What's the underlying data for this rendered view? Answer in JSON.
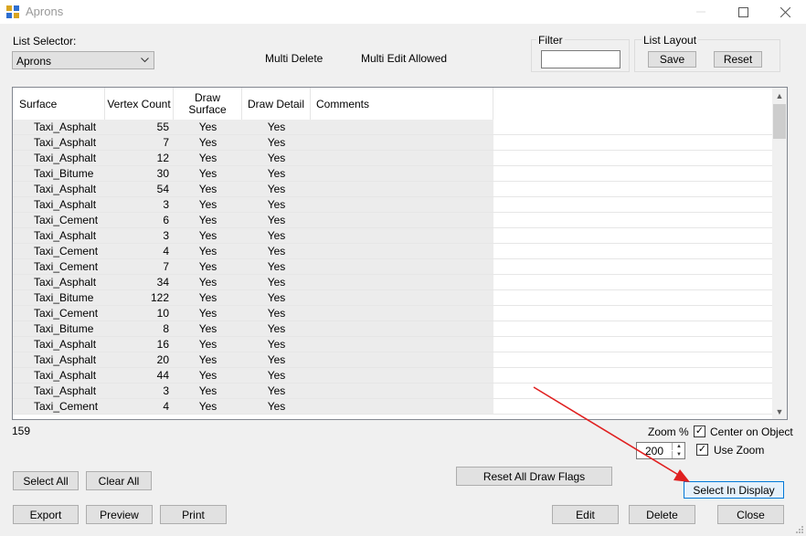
{
  "window": {
    "title": "Aprons"
  },
  "list_selector": {
    "label": "List Selector:",
    "value": "Aprons"
  },
  "multi_delete_label": "Multi Delete",
  "multi_edit_label": "Multi Edit Allowed",
  "filter": {
    "label": "Filter",
    "value": ""
  },
  "list_layout": {
    "label": "List Layout",
    "save": "Save",
    "reset": "Reset"
  },
  "columns": [
    "Surface",
    "Vertex Count",
    "Draw Surface",
    "Draw Detail",
    "Comments"
  ],
  "rows": [
    [
      "Taxi_Asphalt",
      "55",
      "Yes",
      "Yes"
    ],
    [
      "Taxi_Asphalt",
      "7",
      "Yes",
      "Yes"
    ],
    [
      "Taxi_Asphalt",
      "12",
      "Yes",
      "Yes"
    ],
    [
      "Taxi_Bitume",
      "30",
      "Yes",
      "Yes"
    ],
    [
      "Taxi_Asphalt",
      "54",
      "Yes",
      "Yes"
    ],
    [
      "Taxi_Asphalt",
      "3",
      "Yes",
      "Yes"
    ],
    [
      "Taxi_Cement",
      "6",
      "Yes",
      "Yes"
    ],
    [
      "Taxi_Asphalt",
      "3",
      "Yes",
      "Yes"
    ],
    [
      "Taxi_Cement",
      "4",
      "Yes",
      "Yes"
    ],
    [
      "Taxi_Cement",
      "7",
      "Yes",
      "Yes"
    ],
    [
      "Taxi_Asphalt",
      "34",
      "Yes",
      "Yes"
    ],
    [
      "Taxi_Bitume",
      "122",
      "Yes",
      "Yes"
    ],
    [
      "Taxi_Cement",
      "10",
      "Yes",
      "Yes"
    ],
    [
      "Taxi_Bitume",
      "8",
      "Yes",
      "Yes"
    ],
    [
      "Taxi_Asphalt",
      "16",
      "Yes",
      "Yes"
    ],
    [
      "Taxi_Asphalt",
      "20",
      "Yes",
      "Yes"
    ],
    [
      "Taxi_Asphalt",
      "44",
      "Yes",
      "Yes"
    ],
    [
      "Taxi_Asphalt",
      "3",
      "Yes",
      "Yes"
    ],
    [
      "Taxi_Cement",
      "4",
      "Yes",
      "Yes"
    ]
  ],
  "count": "159",
  "zoom": {
    "label": "Zoom %",
    "value": "200"
  },
  "center_on_object": {
    "label": "Center on Object",
    "checked": true
  },
  "use_zoom": {
    "label": "Use Zoom",
    "checked": true
  },
  "buttons": {
    "select_all": "Select All",
    "clear_all": "Clear All",
    "reset_all_draw_flags": "Reset All Draw Flags",
    "select_in_display": "Select In Display",
    "export": "Export",
    "preview": "Preview",
    "print": "Print",
    "edit": "Edit",
    "delete": "Delete",
    "close": "Close"
  },
  "colors": {
    "annotation_arrow": "#e02020",
    "focus_border": "#0078d7"
  }
}
